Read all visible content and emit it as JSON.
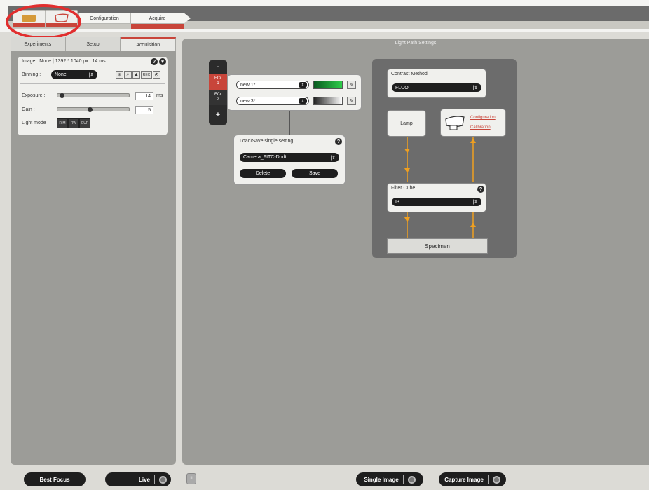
{
  "top_tabs": [
    {
      "label": "Configuration"
    },
    {
      "label": "Acquire"
    }
  ],
  "left_tabs": [
    {
      "label": "Experiments"
    },
    {
      "label": "Setup"
    },
    {
      "label": "Acquisition"
    }
  ],
  "acquisition": {
    "image_info": "Image :  None | 1392 * 1040 px | 14 ms",
    "binning_label": "Binning :",
    "binning_value": "None",
    "exposure_label": "Exposure :",
    "exposure_value": "14",
    "exposure_unit": "ms",
    "exposure_level_pct": 3,
    "gain_label": "Gain :",
    "gain_value": "5",
    "gain_level_pct": 45,
    "light_mode_label": "Light mode :",
    "light_modes": [
      "RIM",
      "RW",
      "CUR"
    ],
    "toolbar_icons": [
      "aperture-icon",
      "magnify-icon",
      "histogram-icon",
      "rec-icon",
      "camera-settings-icon"
    ],
    "rec_text": "REC"
  },
  "right_panel": {
    "title": "Light Path Settings"
  },
  "fcr": {
    "minus": "-",
    "plus": "+",
    "fcr1_line1": "FCr",
    "fcr1_line2": "1",
    "fcr2_line1": "FCr",
    "fcr2_line2": "2",
    "setting1": "new 1*",
    "setting2": "new 3*"
  },
  "load_save": {
    "title": "Load/Save single setting",
    "selected": "Camera_FITC-Dodt",
    "delete_label": "Delete",
    "save_label": "Save"
  },
  "contrast": {
    "title": "Contrast Method",
    "value": "FLUO"
  },
  "lamp": {
    "label": "Lamp",
    "config_link": "Configuration",
    "calib_link": "Calibration"
  },
  "filter_cube": {
    "title": "Filter Cube",
    "value": "I3"
  },
  "specimen": {
    "label": "Specimen"
  },
  "bottom": {
    "best_focus": "Best Focus",
    "live": "Live",
    "pause": "II",
    "single_image": "Single Image",
    "capture_image": "Capture Image"
  },
  "colors": {
    "accent_red": "#c8453a",
    "annotation_red": "#e12e2e",
    "light_path_orange": "#f0a020",
    "panel_gray": "#9c9c98"
  }
}
